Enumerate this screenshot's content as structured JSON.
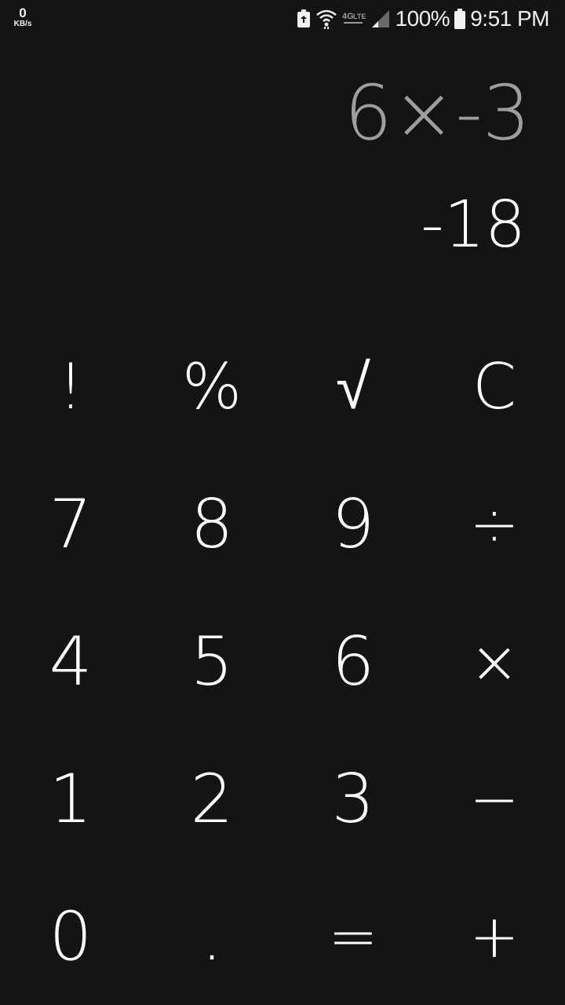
{
  "status_bar": {
    "net_speed_value": "0",
    "net_speed_unit": "KB/s",
    "battery_percent": "100%",
    "time": "9:51 PM",
    "icons": [
      "battery-saver-icon",
      "wifi-icon",
      "lte-icon",
      "cell-signal-icon",
      "battery-icon"
    ]
  },
  "display": {
    "expression": "6×-3",
    "result": "-18"
  },
  "keypad": {
    "rows": [
      [
        "!",
        "%",
        "√",
        "C"
      ],
      [
        "7",
        "8",
        "9",
        "÷"
      ],
      [
        "4",
        "5",
        "6",
        "×"
      ],
      [
        "1",
        "2",
        "3",
        "−"
      ],
      [
        "0",
        ".",
        "=",
        "+"
      ]
    ]
  },
  "colors": {
    "background": "#141414",
    "expression_text": "#9e9e9e",
    "result_text": "#ffffff",
    "key_text": "#ffffff"
  }
}
